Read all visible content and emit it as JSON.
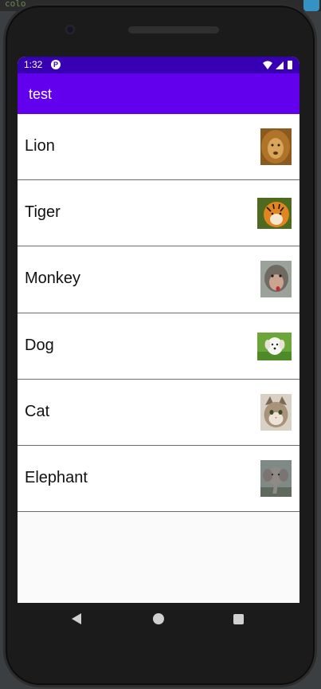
{
  "ide": {
    "fragment_text": "colo"
  },
  "status_bar": {
    "time": "1:32",
    "app_icon_letter": "P"
  },
  "app_bar": {
    "title": "test"
  },
  "animals": [
    {
      "label": "Lion",
      "icon": "lion-photo"
    },
    {
      "label": "Tiger",
      "icon": "tiger-photo"
    },
    {
      "label": "Monkey",
      "icon": "monkey-photo"
    },
    {
      "label": "Dog",
      "icon": "dog-photo"
    },
    {
      "label": "Cat",
      "icon": "cat-photo"
    },
    {
      "label": "Elephant",
      "icon": "elephant-photo"
    }
  ],
  "nav_bar": {
    "back_icon": "back-triangle-icon",
    "home_icon": "home-circle-icon",
    "recents_icon": "recents-square-icon"
  },
  "colors": {
    "status_bar": "#3700b3",
    "app_bar": "#6200ee",
    "divider": "#6c6c6c",
    "screen_bg": "#fafafa"
  }
}
